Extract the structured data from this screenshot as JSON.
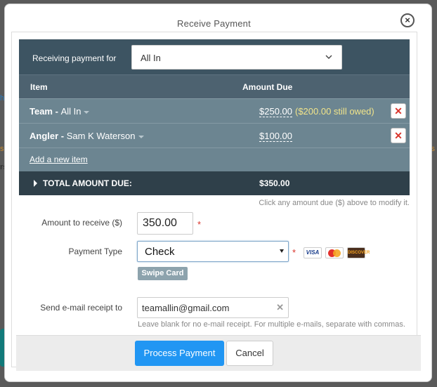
{
  "modal": {
    "title": "Receive Payment",
    "close_label": "×"
  },
  "receiving": {
    "label": "Receiving payment for",
    "selected": "All In"
  },
  "table": {
    "col_item": "Item",
    "col_amount": "Amount Due",
    "rows": [
      {
        "type": "Team",
        "sep": " - ",
        "name": "All In",
        "amount": "$250.00",
        "owed": "($200.00 still owed)"
      },
      {
        "type": "Angler",
        "sep": " - ",
        "name": "Sam K Waterson",
        "amount": "$100.00",
        "owed": ""
      }
    ],
    "add_item": "Add a new item",
    "total_label": "TOTAL AMOUNT DUE:",
    "total_amount": "$350.00",
    "hint": "Click any amount due ($) above to modify it."
  },
  "form": {
    "amount_label": "Amount to receive ($)",
    "amount_value": "350.00",
    "payment_type_label": "Payment Type",
    "payment_type_value": "Check",
    "swipe_card": "Swipe Card",
    "cards": [
      "VISA",
      "mastercard",
      "DISCOVER"
    ],
    "email_label": "Send e-mail receipt to",
    "email_value": "teamallin@gmail.com",
    "email_hint": "Leave blank for no e-mail receipt. For multiple e-mails, separate with commas."
  },
  "footer": {
    "process": "Process Payment",
    "cancel": "Cancel"
  },
  "colors": {
    "header_dark": "#3d5462",
    "row_item": "#6c8591",
    "total_row": "#2f404a",
    "owed_text": "#f1e48a",
    "primary": "#2196f3",
    "delete": "#d9342b"
  }
}
